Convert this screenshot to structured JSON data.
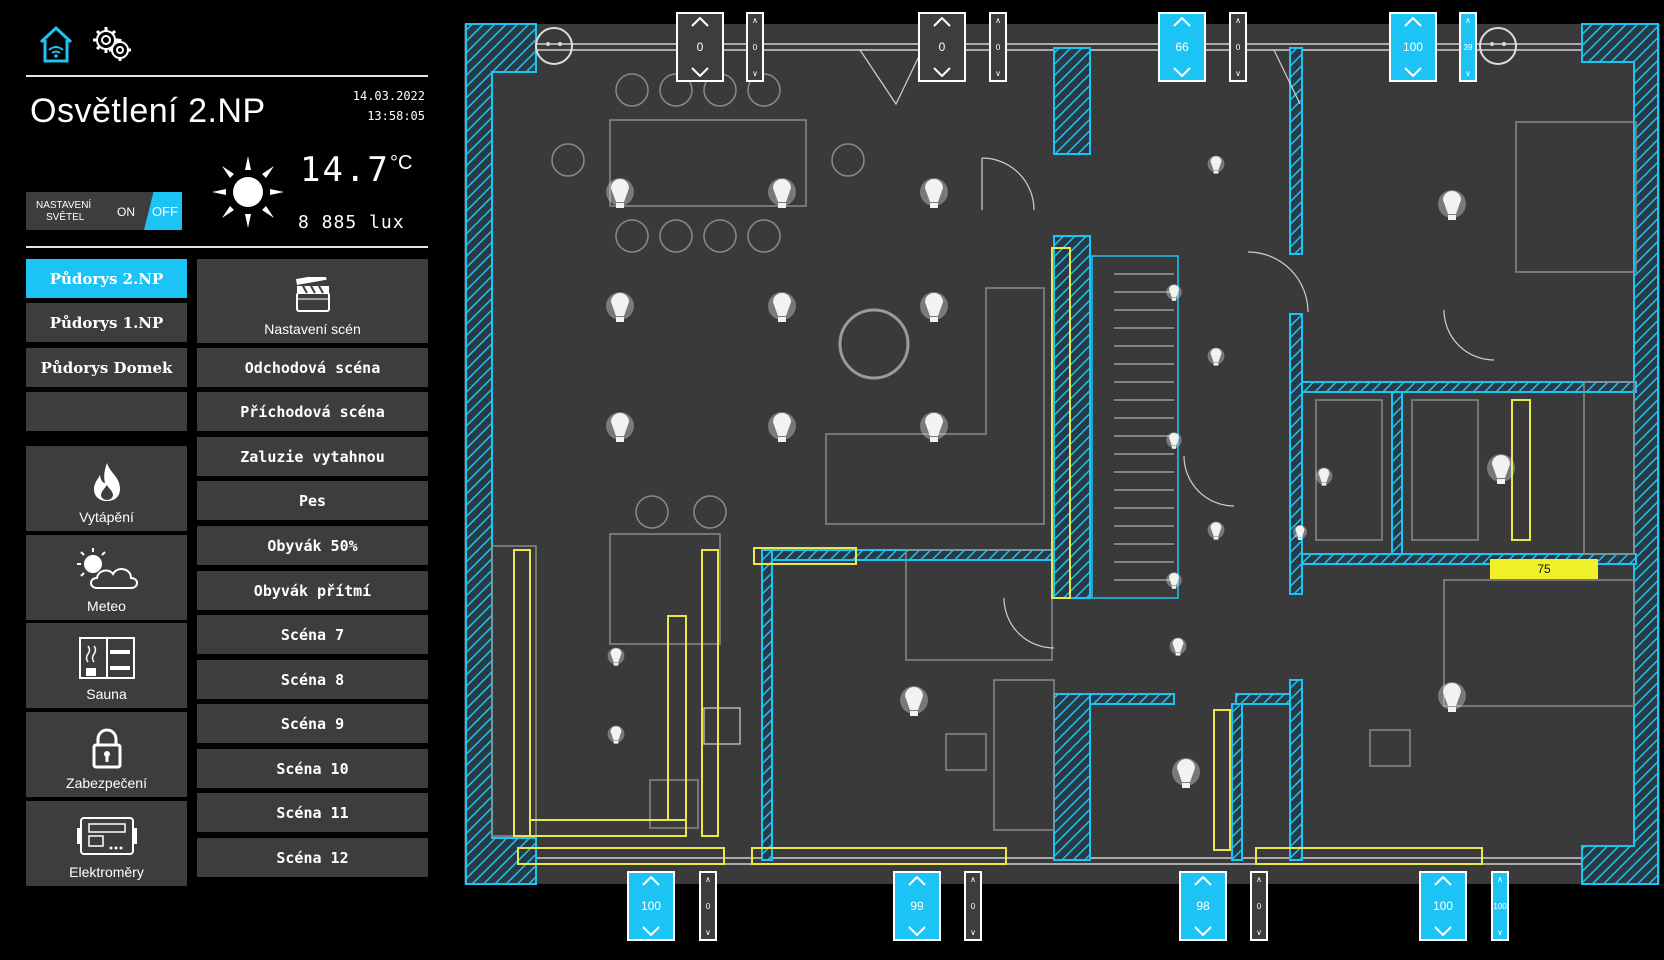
{
  "header": {
    "title": "Osvětlení 2.NP",
    "date": "14.03.2022",
    "time": "13:58:05"
  },
  "weather": {
    "temperature": "14.7",
    "temperature_unit": "°C",
    "lux": "8 885 lux",
    "icon": "sun-icon"
  },
  "light_settings": {
    "label_line1": "NASTAVENÍ",
    "label_line2": "SVĚTEL",
    "on_label": "ON",
    "off_label": "OFF",
    "state": "OFF"
  },
  "nav": {
    "items": [
      {
        "label": "Půdorys 2.NP",
        "active": true
      },
      {
        "label": "Půdorys 1.NP",
        "active": false
      },
      {
        "label": "Půdorys Domek",
        "active": false
      },
      {
        "label": "",
        "active": false
      }
    ]
  },
  "tiles": [
    {
      "label": "Vytápění",
      "icon": "flame-icon"
    },
    {
      "label": "Meteo",
      "icon": "sun-cloud-icon"
    },
    {
      "label": "Sauna",
      "icon": "sauna-icon"
    },
    {
      "label": "Zabezpečení",
      "icon": "lock-icon"
    },
    {
      "label": "Elektroměry",
      "icon": "meter-icon"
    }
  ],
  "scenes": {
    "settings_label": "Nastavení scén",
    "items": [
      "Odchodová scéna",
      "Příchodová scéna",
      "Zaluzie vytahnou",
      "Pes",
      "Obyvák 50%",
      "Obyvák přítmí",
      "Scéna 7",
      "Scéna 8",
      "Scéna 9",
      "Scéna 10",
      "Scéna 11",
      "Scéna 12"
    ]
  },
  "blinds_top": [
    {
      "position": "0",
      "slat": "0",
      "active": false
    },
    {
      "position": "0",
      "slat": "0",
      "active": false
    },
    {
      "position": "66",
      "slat": "0",
      "active": true
    },
    {
      "position": "100",
      "slat": "39",
      "active": true
    }
  ],
  "blinds_bottom": [
    {
      "position": "100",
      "slat": "0",
      "active": true
    },
    {
      "position": "99",
      "slat": "0",
      "active": true
    },
    {
      "position": "98",
      "slat": "0",
      "active": true
    },
    {
      "position": "100",
      "slat": "100",
      "active": true
    }
  ],
  "floorplan": {
    "dimmer_value": "75",
    "colors": {
      "wall": "#1cc4f5",
      "light_strip": "#e8e84a",
      "floor": "#3a3a3a",
      "accent": "#1cc4f5"
    }
  }
}
